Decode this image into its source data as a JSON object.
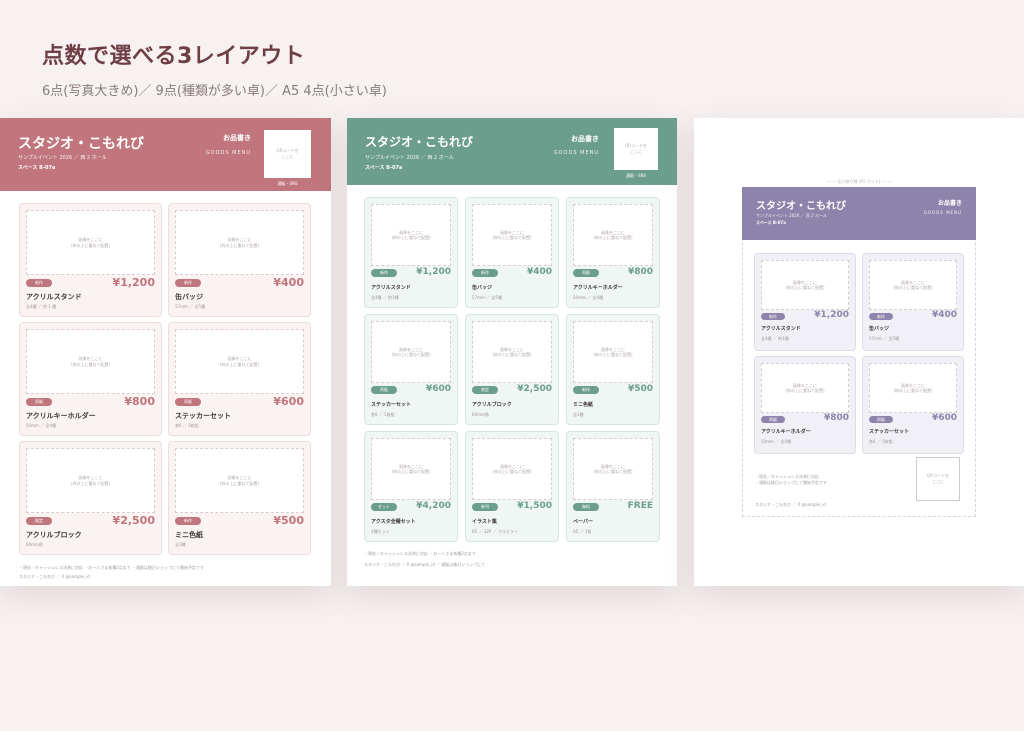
{
  "heading": {
    "title": "点数で選べる3レイアウト",
    "subtitle": "6点(写真大きめ)／ 9点(種類が多い卓)／ A5 4点(小さい卓)"
  },
  "colors": {
    "background": "#f7f1f1",
    "rose": "#c0767c",
    "sage": "#6c9e8d",
    "lavender": "#8e84ab"
  },
  "common": {
    "shop_name": "スタジオ・こもれび",
    "event": "サンプルイベント 2026 ／ 西 2 ホール",
    "space": "スペース B-07a",
    "menu_title": "お品書き",
    "menu_en": "GOODS MENU",
    "photo_placeholder": "画像をここに\n(枠の上に重ねて配置)",
    "qr_placeholder": "QRコードを\nここに",
    "qr_caption": "通販・SNS",
    "credit": "スタジオ・こもれび ／ X @sample_id"
  },
  "sheet_a": {
    "items": [
      {
        "badge": "新作",
        "price": "¥1,200",
        "name": "アクリルスタンド",
        "spec": "全4種 ／ 約 1 種"
      },
      {
        "badge": "新作",
        "price": "¥400",
        "name": "缶バッジ",
        "spec": "57mm ／ 全5種"
      },
      {
        "badge": "再販",
        "price": "¥800",
        "name": "アクリルキーホルダー",
        "spec": "50mm ／ 全4種"
      },
      {
        "badge": "再販",
        "price": "¥600",
        "name": "ステッカーセット",
        "spec": "各6 ／ 5枚組"
      },
      {
        "badge": "限定",
        "price": "¥2,500",
        "name": "アクリルブロック",
        "spec": "60mm角"
      },
      {
        "badge": "新作",
        "price": "¥500",
        "name": "ミニ色紙",
        "spec": "全3種"
      }
    ],
    "footer": "・現金／キャッシュレス決済に対応 ・お一人さま各種2点まで ・通販は後日ショップにて開始予定です"
  },
  "sheet_b": {
    "items": [
      {
        "badge": "新作",
        "price": "¥1,200",
        "name": "アクリルスタンド",
        "spec": "全4種 ／ 約1種"
      },
      {
        "badge": "新作",
        "price": "¥400",
        "name": "缶バッジ",
        "spec": "57mm ／ 全5種"
      },
      {
        "badge": "再販",
        "price": "¥800",
        "name": "アクリルキーホルダー",
        "spec": "50mm ／ 全4種"
      },
      {
        "badge": "再販",
        "price": "¥600",
        "name": "ステッカーセット",
        "spec": "各6 ／ 5枚組"
      },
      {
        "badge": "限定",
        "price": "¥2,500",
        "name": "アクリルブロック",
        "spec": "60mm角"
      },
      {
        "badge": "新作",
        "price": "¥500",
        "name": "ミニ色紙",
        "spec": "全3種"
      },
      {
        "badge": "セット",
        "price": "¥4,200",
        "name": "アクスタ全種セット",
        "spec": "4種セット"
      },
      {
        "badge": "新刊",
        "price": "¥1,500",
        "name": "イラスト集",
        "spec": "B5 ／ 32P ／ フルカラー"
      },
      {
        "badge": "無料",
        "price": "FREE",
        "name": "ペーパー",
        "spec": "A5 ／ 1枚"
      }
    ],
    "footer": "・現金／キャッシュレス決済に対応 ・お一人さま各種2点まで",
    "credit": "スタジオ・こもれび ／ X @sample_id ／ 通販は後日ショップにて"
  },
  "sheet_c": {
    "cut_label": "— — 切り取り線 (A5 ガイド) — —",
    "items": [
      {
        "badge": "新作",
        "price": "¥1,200",
        "name": "アクリルスタンド",
        "spec": "全4種 ／ 約1種"
      },
      {
        "badge": "新作",
        "price": "¥400",
        "name": "缶バッジ",
        "spec": "57mm ／ 全5種"
      },
      {
        "badge": "再販",
        "price": "¥800",
        "name": "アクリルキーホルダー",
        "spec": "50mm ／ 全4種"
      },
      {
        "badge": "再販",
        "price": "¥600",
        "name": "ステッカーセット",
        "spec": "各6 ／ 5枚組"
      }
    ],
    "footer": "・現金／キャッシュレス決済に対応\n・通販は後日ショップにて開始予定です"
  }
}
